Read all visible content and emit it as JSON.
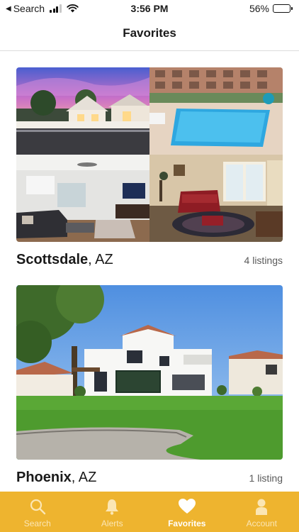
{
  "status_bar": {
    "back_app": "Search",
    "time": "3:56 PM",
    "battery_percent": "56%",
    "battery_level": 0.56,
    "signal_bars_active": 3,
    "signal_bars_total": 4
  },
  "nav": {
    "title": "Favorites"
  },
  "favorites": [
    {
      "city": "Scottsdale",
      "state": ", AZ",
      "count": "4 listings",
      "photos": [
        "house-exterior-dusk",
        "apartment-pool",
        "modern-living-room",
        "traditional-living-room"
      ]
    },
    {
      "city": "Phoenix",
      "state": ", AZ",
      "count": "1 listing",
      "photos": [
        "white-house-lawn"
      ]
    }
  ],
  "tabs": [
    {
      "label": "Search",
      "icon": "search-icon",
      "active": false
    },
    {
      "label": "Alerts",
      "icon": "bell-icon",
      "active": false
    },
    {
      "label": "Favorites",
      "icon": "heart-icon",
      "active": true
    },
    {
      "label": "Account",
      "icon": "person-icon",
      "active": false
    }
  ],
  "colors": {
    "accent": "#eeb42f",
    "tab_inactive": "#fbe6b4",
    "tab_active": "#ffffff",
    "divider": "#dcdcdc"
  }
}
